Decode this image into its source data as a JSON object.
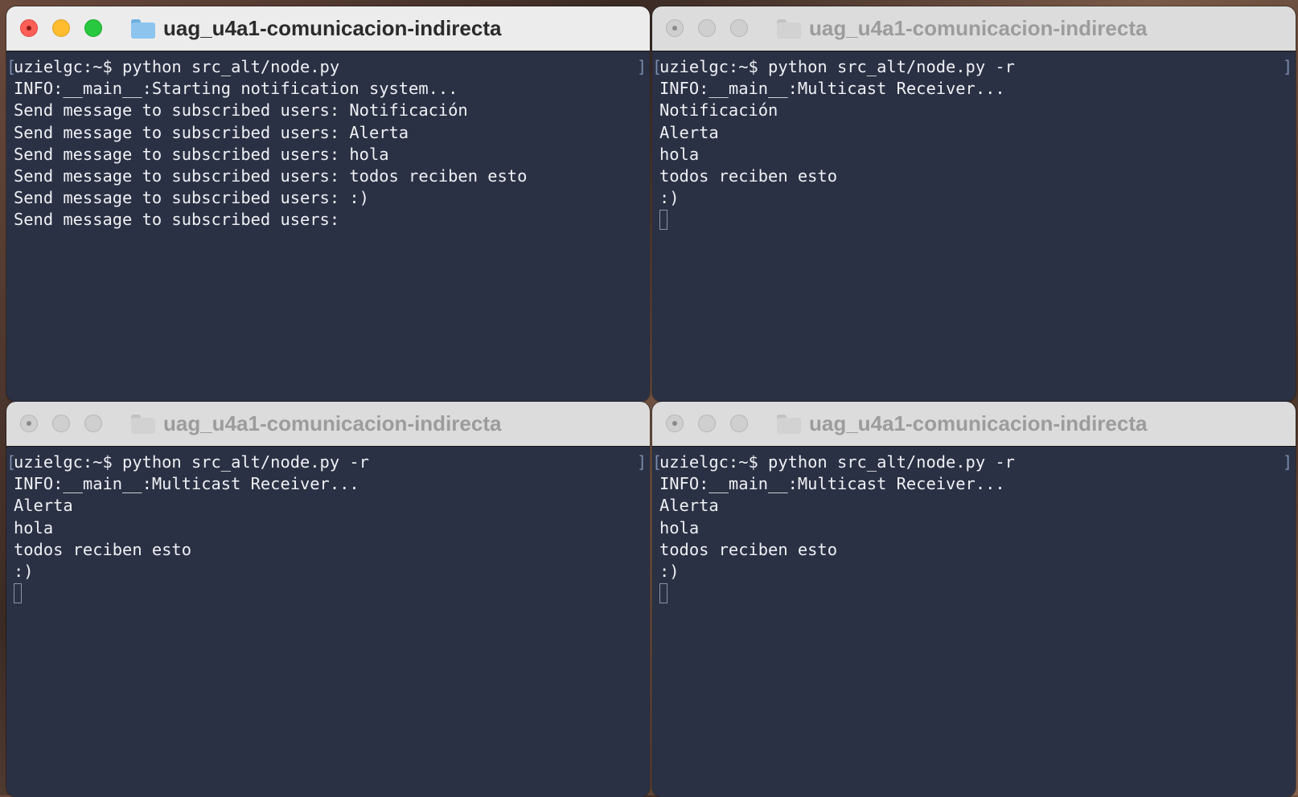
{
  "windows": [
    {
      "title": "uag_u4a1-comunicacion-indirecta",
      "lines": [
        "uzielgc:~$ python src_alt/node.py",
        "INFO:__main__:Starting notification system...",
        "Send message to subscribed users: Notificación",
        "Send message to subscribed users: Alerta",
        "Send message to subscribed users: hola",
        "Send message to subscribed users: todos reciben esto",
        "Send message to subscribed users: :)",
        "Send message to subscribed users:"
      ]
    },
    {
      "title": "uag_u4a1-comunicacion-indirecta",
      "lines": [
        "uzielgc:~$ python src_alt/node.py -r",
        "INFO:__main__:Multicast Receiver...",
        "Notificación",
        "Alerta",
        "hola",
        "todos reciben esto",
        ":)"
      ]
    },
    {
      "title": "uag_u4a1-comunicacion-indirecta",
      "lines": [
        "uzielgc:~$ python src_alt/node.py -r",
        "INFO:__main__:Multicast Receiver...",
        "Alerta",
        "hola",
        "todos reciben esto",
        ":)"
      ]
    },
    {
      "title": "uag_u4a1-comunicacion-indirecta",
      "lines": [
        "uzielgc:~$ python src_alt/node.py -r",
        "INFO:__main__:Multicast Receiver...",
        "Alerta",
        "hola",
        "todos reciben esto",
        ":)"
      ]
    }
  ],
  "colors": {
    "terminal_bg": "#2b3144",
    "terminal_fg": "#eef0f4",
    "close": "#fe5f57",
    "minimize": "#febc2e",
    "maximize": "#28c840"
  }
}
